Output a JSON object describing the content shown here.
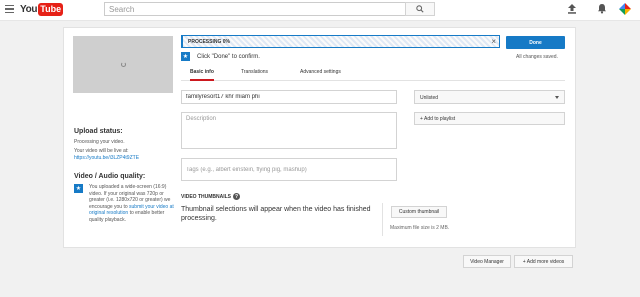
{
  "header": {
    "logo_you": "You",
    "logo_tube": "Tube",
    "search_placeholder": "Search"
  },
  "left_panel": {
    "upload_status_title": "Upload status:",
    "upload_status_text": "Processing your video.",
    "video_live_text": "Your video will be live at:",
    "video_link": "https://youtu.be/i3LZP4t9ZTE",
    "quality_title": "Video / Audio quality:",
    "quality_text_1": "You uploaded a wide-screen (16:9) video. If your original was 720p or greater (i.e. 1280x720 or greater) we encourage you to ",
    "quality_link": "submit your video at original resolution",
    "quality_text_2": " to enable better quality playback."
  },
  "progress": {
    "label": "PROCESSING 0%",
    "percent": 0
  },
  "actions": {
    "done_label": "Done",
    "saved_text": "All changes saved.",
    "click_done_text": "Click \"Done\" to confirm."
  },
  "tabs": [
    {
      "label": "Basic info",
      "active": true
    },
    {
      "label": "Translations",
      "active": false
    },
    {
      "label": "Advanced settings",
      "active": false
    }
  ],
  "form": {
    "title_value": "familyresort17 khr miam phi",
    "description_placeholder": "Description",
    "tags_placeholder": "Tags (e.g., albert einstein, flying pig, mashup)",
    "privacy_value": "Unlisted",
    "add_playlist_label": "+ Add to playlist"
  },
  "thumbnails": {
    "title": "VIDEO THUMBNAILS",
    "help_glyph": "?",
    "text": "Thumbnail selections will appear when the video has finished processing.",
    "custom_thumbnail_label": "Custom thumbnail",
    "max_size_text": "Maximum file size is 2 MB."
  },
  "footer": {
    "video_manager_label": "Video Manager",
    "add_more_label": "+ Add more videos"
  },
  "colors": {
    "accent_blue": "#167ac6",
    "youtube_red": "#e62117"
  }
}
